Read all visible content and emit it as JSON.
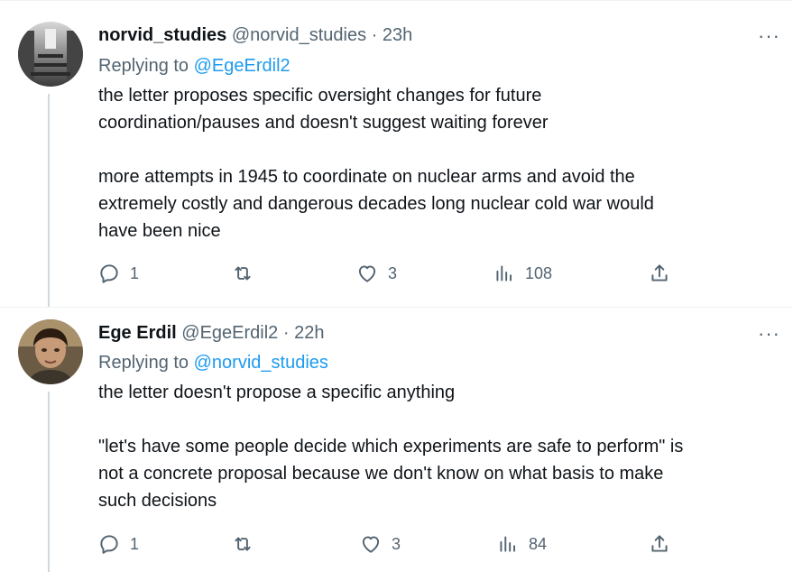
{
  "tweets": [
    {
      "name": "norvid_studies",
      "handle": "@norvid_studies",
      "dot": "·",
      "time": "23h",
      "replying_prefix": "Replying to",
      "replying_to": "@EgeErdil2",
      "paragraphs": [
        "the letter proposes specific oversight changes for future",
        "coordination/pauses and doesn't suggest waiting forever",
        "more attempts in 1945 to coordinate on nuclear arms and avoid the",
        "extremely costly and dangerous decades long nuclear cold war would",
        "have been nice"
      ],
      "more_label": "···",
      "actions": {
        "replies": "1",
        "retweets": "",
        "likes": "3",
        "views": "108"
      },
      "avatar_icon": "library-hall-photo"
    },
    {
      "name": "Ege Erdil",
      "handle": "@EgeErdil2",
      "dot": "·",
      "time": "22h",
      "replying_prefix": "Replying to",
      "replying_to": "@norvid_studies",
      "paragraphs": [
        "the letter doesn't propose a specific anything",
        "\"let's have some people decide which experiments are safe to perform\" is",
        "not a concrete proposal because we don't know on what basis to make",
        "such decisions"
      ],
      "more_label": "···",
      "actions": {
        "replies": "1",
        "retweets": "",
        "likes": "3",
        "views": "84"
      },
      "avatar_icon": "person-photo"
    }
  ],
  "icons": [
    "reply-icon",
    "retweet-icon",
    "like-icon",
    "views-icon",
    "share-icon",
    "more-icon"
  ],
  "colors": {
    "link": "#1d9bf0",
    "muted": "#536471",
    "text": "#0f1419",
    "line": "#cfd9de"
  }
}
